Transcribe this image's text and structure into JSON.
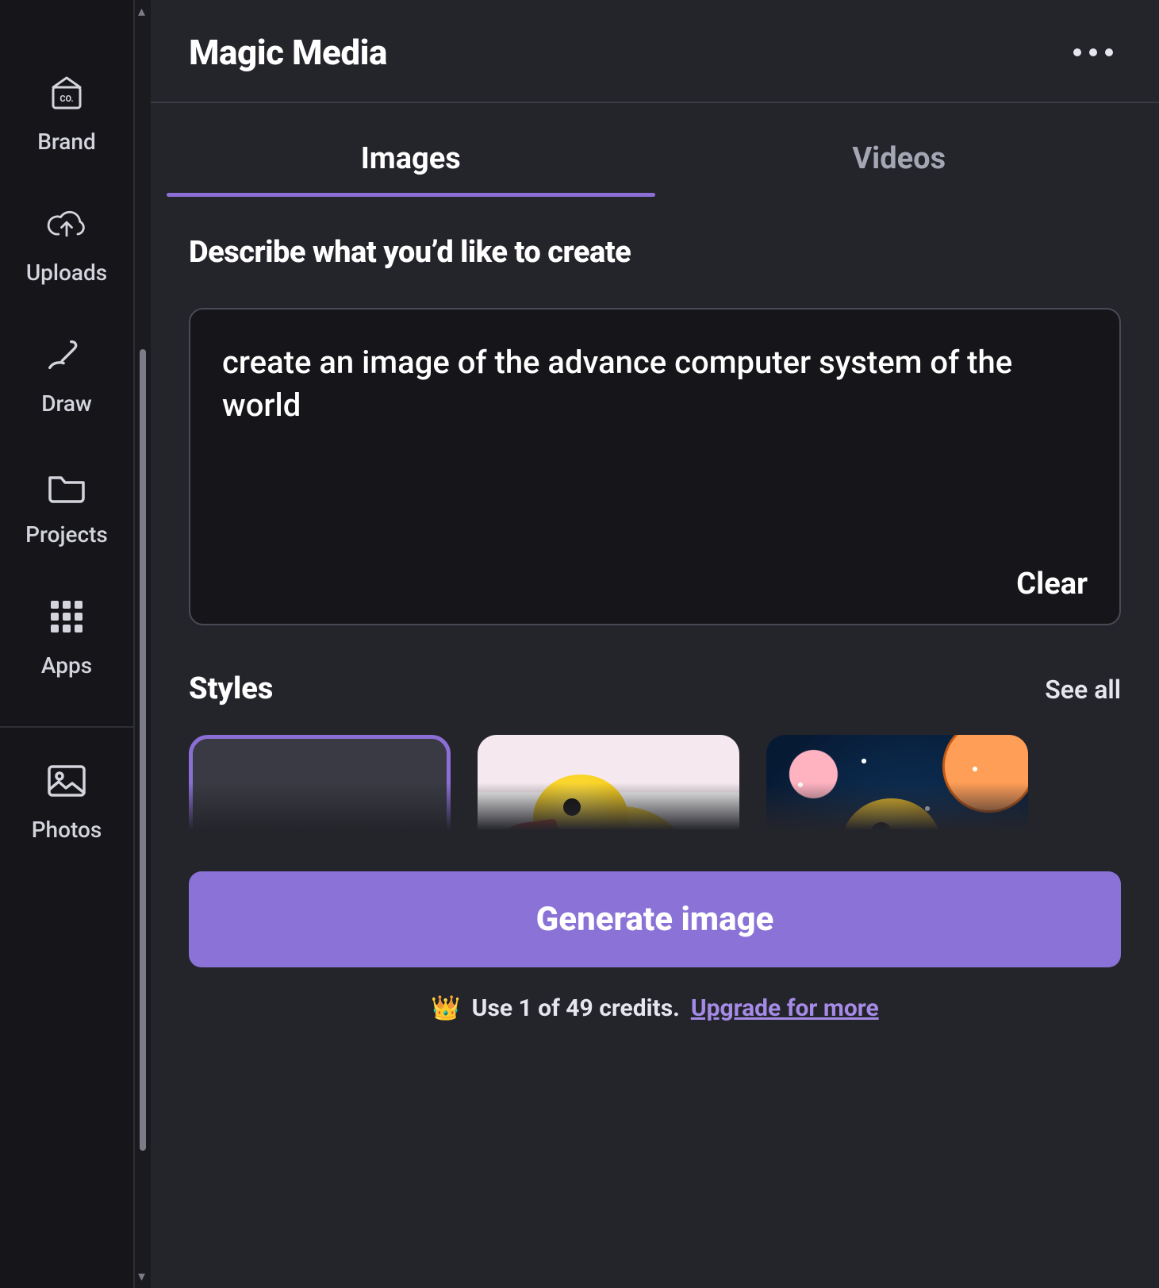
{
  "rail": {
    "items": [
      {
        "key": "brand",
        "label": "Brand"
      },
      {
        "key": "uploads",
        "label": "Uploads"
      },
      {
        "key": "draw",
        "label": "Draw"
      },
      {
        "key": "projects",
        "label": "Projects"
      },
      {
        "key": "apps",
        "label": "Apps"
      }
    ],
    "bottom": {
      "key": "photos",
      "label": "Photos"
    }
  },
  "panel": {
    "title": "Magic Media",
    "tabs": {
      "images": "Images",
      "videos": "Videos",
      "active": "images"
    },
    "describe_label": "Describe what you’d like to create",
    "prompt_value": "create an image of the advance computer system of the world",
    "clear_label": "Clear",
    "styles": {
      "title": "Styles",
      "see_all": "See all",
      "items": [
        {
          "key": "none",
          "selected": true
        },
        {
          "key": "watercolor",
          "selected": false
        },
        {
          "key": "dreamy",
          "selected": false
        }
      ]
    },
    "generate_label": "Generate image",
    "credits": {
      "text": "Use 1 of 49 credits.",
      "upgrade": "Upgrade for more"
    }
  }
}
